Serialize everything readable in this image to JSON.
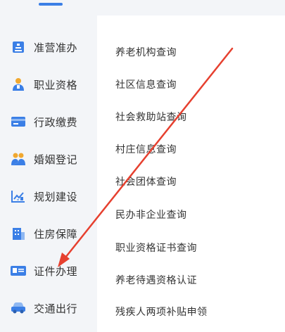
{
  "colors": {
    "accent": "#3b7fe6",
    "arrow": "#e6402f"
  },
  "sidebar": {
    "items": [
      {
        "label": "准营准办",
        "icon": "building-icon"
      },
      {
        "label": "职业资格",
        "icon": "person-icon"
      },
      {
        "label": "行政缴费",
        "icon": "payment-icon"
      },
      {
        "label": "婚姻登记",
        "icon": "couple-icon"
      },
      {
        "label": "规划建设",
        "icon": "chart-icon"
      },
      {
        "label": "住房保障",
        "icon": "house-icon"
      },
      {
        "label": "证件办理",
        "icon": "id-card-icon"
      },
      {
        "label": "交通出行",
        "icon": "car-icon"
      }
    ]
  },
  "content": {
    "items": [
      {
        "label": "养老机构查询"
      },
      {
        "label": "社区信息查询"
      },
      {
        "label": "社会救助站查询"
      },
      {
        "label": "村庄信息查询"
      },
      {
        "label": "社会团体查询"
      },
      {
        "label": "民办非企业查询"
      },
      {
        "label": "职业资格证书查询"
      },
      {
        "label": "养老待遇资格认证"
      },
      {
        "label": "残疾人两项补贴申领"
      }
    ]
  }
}
